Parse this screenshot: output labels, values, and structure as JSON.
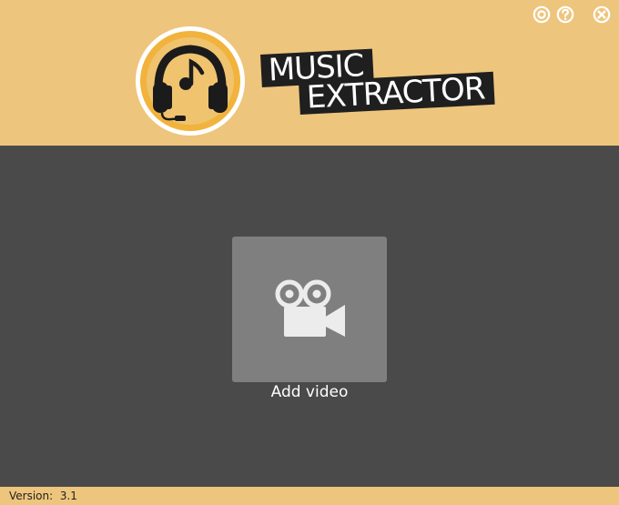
{
  "header": {
    "logo_line1": "MUSIC",
    "logo_line2": "EXTRACTOR",
    "bg_color": "#eec57d",
    "controls": [
      {
        "icon": "settings-icon"
      },
      {
        "icon": "help-icon"
      },
      {
        "icon": "close-icon"
      }
    ]
  },
  "main": {
    "add_video_label": "Add video",
    "tile_icon": "video-camera-icon",
    "bg_color": "#4a4a4a",
    "tile_color": "#7f7f7f"
  },
  "footer": {
    "version_label": "Version:",
    "version_value": "3.1"
  }
}
